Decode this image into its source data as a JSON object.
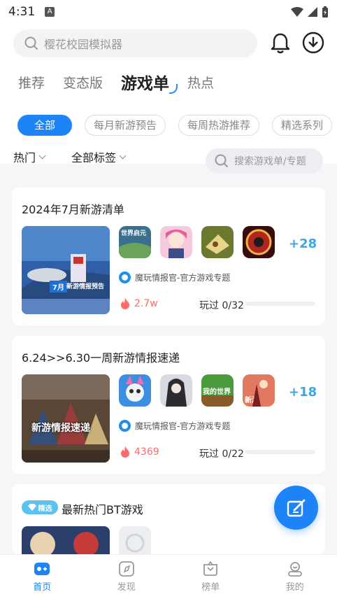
{
  "status_bar": {
    "time": "4:31",
    "app_indicator": "A"
  },
  "search": {
    "placeholder": "樱花校园模拟器"
  },
  "tabs": [
    {
      "label": "推荐"
    },
    {
      "label": "变态版"
    },
    {
      "label": "游戏单",
      "active": true
    },
    {
      "label": "热点"
    }
  ],
  "chips": [
    {
      "label": "全部",
      "active": true
    },
    {
      "label": "每月新游预告"
    },
    {
      "label": "每周热游推荐"
    },
    {
      "label": "精选系列"
    }
  ],
  "filters": {
    "hot": "热门",
    "tags": "全部标签",
    "search_placeholder": "搜索游戏单/专题"
  },
  "cards": [
    {
      "title": "2024年7月新游清单",
      "cover_text": "新游情报预告",
      "cover_month": "7月",
      "more": "+28",
      "author": "魔玩情报官-官方游戏专题",
      "heat": "2.7w",
      "played": "玩过 0/32",
      "played_fraction": 0
    },
    {
      "title": "6.24>>6.30一周新游情报速递",
      "cover_text": "新游情报速递",
      "more": "+18",
      "author": "魔玩情报官-官方游戏专题",
      "heat": "4369",
      "played": "玩过 0/22",
      "played_fraction": 0
    },
    {
      "badge": "精选",
      "title": "最新热门BT游戏"
    }
  ],
  "icon_labels": {
    "civilization": "世界启元",
    "world": "我的世界",
    "newgame": "新游"
  },
  "bottom_nav": [
    {
      "label": "首页",
      "active": true,
      "icon": "home-icon"
    },
    {
      "label": "发现",
      "icon": "compass-icon"
    },
    {
      "label": "榜单",
      "icon": "trophy-icon"
    },
    {
      "label": "我的",
      "icon": "profile-icon"
    }
  ],
  "colors": {
    "accent": "#1e83f6",
    "heat": "#ff6b6b",
    "more": "#3aa7e8"
  }
}
